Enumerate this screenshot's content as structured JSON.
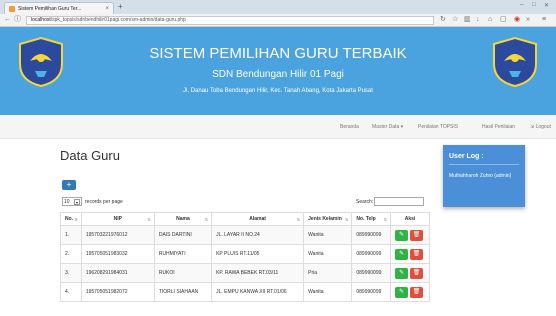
{
  "browser": {
    "tab_title": "Sistem Pemilihan Guru Ter...",
    "tab_close": "×",
    "new_tab": "+",
    "url_host": "localhost",
    "url_path": "/spk_topsis/sdnbendhilir01pagi.com/sm-admin/data-guru.php"
  },
  "header": {
    "title": "SISTEM PEMILIHAN GURU TERBAIK",
    "school": "SDN Bendungan Hilir 01 Pagi",
    "address": "Jl. Danau Toba Bendungan Hilir, Kec. Tanah Abang, Kota Jakarta Pusat"
  },
  "nav": {
    "beranda": "Beranda",
    "master_data": "Master Data ▾",
    "penilaian_topsis": "Penilaian TOPSIS",
    "hasil_penilaian": "Hasil Penilaian",
    "logout": "Logout"
  },
  "page": {
    "heading": "Data Guru",
    "add_button": "+",
    "length_value": "10",
    "length_label": "records per page",
    "search_label": "Search:"
  },
  "table": {
    "headers": [
      "No.",
      "NIP",
      "Nama",
      "Alamat",
      "Jenis Kelamin",
      "No. Telp",
      "Aksi"
    ],
    "rows": [
      {
        "no": "1.",
        "nip": "195703221976012",
        "nama": "DAIS DARTINI",
        "alamat": "JL. LAYAR II NO.24",
        "jk": "Wanita",
        "telp": "089990099"
      },
      {
        "no": "2.",
        "nip": "195705051983032",
        "nama": "RUHMIYATI",
        "alamat": "KP PLUIS RT.11/05",
        "jk": "Wanita",
        "telp": "089990099"
      },
      {
        "no": "3.",
        "nip": "196208291984031",
        "nama": "RUKOI",
        "alamat": "KP. RAWA BEBEK RT.03/11",
        "jk": "Pria",
        "telp": "089990099"
      },
      {
        "no": "4.",
        "nip": "195705051982072",
        "nama": "TIORLI SIAHAAN",
        "alamat": "JL. EMPU KANWA XII RT.01/06",
        "jk": "Wanita",
        "telp": "089990099"
      }
    ]
  },
  "user_log": {
    "title": "User Log :",
    "user": "Muthahharoh Zuhro (admin)"
  },
  "colors": {
    "banner": "#4aa3df",
    "userlog": "#4a8fd8",
    "edit": "#2fb344",
    "delete": "#e04e3e",
    "add": "#337ab7"
  }
}
